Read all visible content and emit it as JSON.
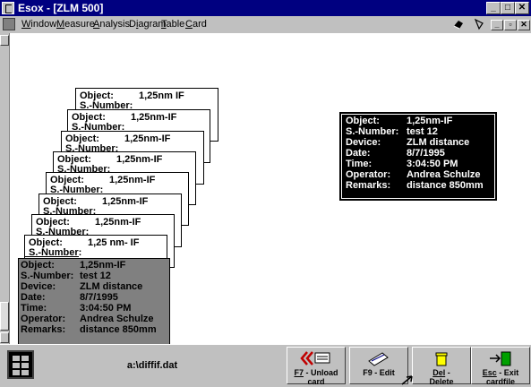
{
  "window": {
    "title": "Esox - [ZLM 500]",
    "minimize": "_",
    "maximize": "□",
    "close": "✕"
  },
  "menu": {
    "items": [
      {
        "key": "W",
        "rest": "indow"
      },
      {
        "key": "M",
        "rest": "easure"
      },
      {
        "key": "A",
        "rest": "nalysis"
      },
      {
        "pre": "D",
        "key": "i",
        "rest": "agram"
      },
      {
        "key": "T",
        "rest": "able"
      },
      {
        "key": "C",
        "rest": "ard"
      }
    ],
    "tool_icons": [
      "eraser-icon",
      "pencil-icon",
      "filter-icon"
    ],
    "mdi_minimize": "_",
    "mdi_restore": "▫",
    "mdi_close": "✕"
  },
  "stack_cards": [
    {
      "object_label": "Object:",
      "object_value": "1,25nm IF",
      "snumber_label": "S.-Number:"
    },
    {
      "object_label": "Object:",
      "object_value": "1,25nm-IF",
      "snumber_label": "S.-Number:"
    },
    {
      "object_label": "Object:",
      "object_value": "1,25nm-IF",
      "snumber_label": "S.-Number:"
    },
    {
      "object_label": "Object:",
      "object_value": "1,25nm-IF",
      "snumber_label": "S.-Number:"
    },
    {
      "object_label": "Object:",
      "object_value": "1,25nm-IF",
      "snumber_label": "S.-Number:"
    },
    {
      "object_label": "Object:",
      "object_value": "1,25nm-IF",
      "snumber_label": "S.-Number:"
    },
    {
      "object_label": "Object:",
      "object_value": "1,25nm-IF",
      "snumber_label": "S.-Number:"
    },
    {
      "object_label": "Object:",
      "object_value": "1,25 nm- IF",
      "snumber_label": "S.-Number:"
    }
  ],
  "front_card": {
    "rows": [
      {
        "label": "Object:",
        "value": "1,25nm-IF"
      },
      {
        "label": "S.-Number:",
        "value": "test 12"
      },
      {
        "label": "Device:",
        "value": "ZLM distance"
      },
      {
        "label": "Date:",
        "value": "8/7/1995"
      },
      {
        "label": "Time:",
        "value": "3:04:50 PM"
      },
      {
        "label": "Operator:",
        "value": "Andrea Schulze"
      },
      {
        "label": "Remarks:",
        "value": "distance 850mm"
      }
    ]
  },
  "info_card": {
    "rows": [
      {
        "label": "Object:",
        "value": "1,25nm-IF"
      },
      {
        "label": "S.-Number:",
        "value": "test 12"
      },
      {
        "label": "Device:",
        "value": "ZLM distance"
      },
      {
        "label": "Date:",
        "value": "8/7/1995"
      },
      {
        "label": "Time:",
        "value": "3:04:50 PM"
      },
      {
        "label": "Operator:",
        "value": "Andrea Schulze"
      },
      {
        "label": "Remarks:",
        "value": "distance 850mm"
      }
    ]
  },
  "bottom": {
    "filename": "a:\\diffif.dat",
    "buttons": [
      {
        "key": "F7",
        "line1": " - Unload",
        "line2": "card"
      },
      {
        "key": "",
        "line1": "F9 - Edit",
        "line2": ""
      },
      {
        "key": "Del",
        "line1": " -",
        "line2": "Delete"
      },
      {
        "key": "Esc",
        "line1": " - Exit",
        "line2": "cardfile"
      }
    ]
  },
  "colors": {
    "title_bar": "#000080",
    "front_card": "#808080",
    "info_card": "#000000"
  }
}
